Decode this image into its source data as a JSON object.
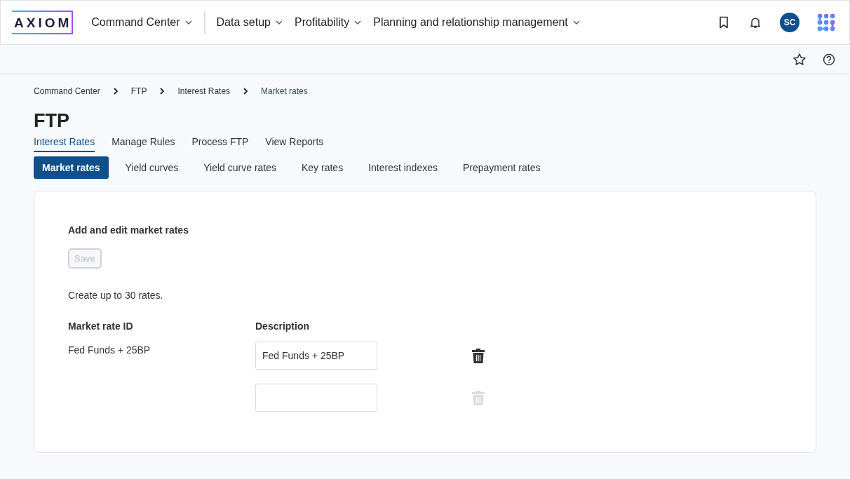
{
  "header": {
    "logo": "AXIOM",
    "nav": [
      {
        "label": "Command Center",
        "kind": "dropdown"
      },
      {
        "label": "Data setup",
        "kind": "dropdown"
      },
      {
        "label": "Profitability",
        "kind": "dropdown"
      },
      {
        "label": "Planning and relationship management",
        "kind": "dropdown"
      }
    ],
    "avatar": "SC"
  },
  "breadcrumb": [
    {
      "label": "Command Center",
      "selected": false
    },
    {
      "label": "FTP",
      "selected": false
    },
    {
      "label": "Interest Rates",
      "selected": false
    },
    {
      "label": "Market rates",
      "selected": true
    }
  ],
  "page_title": "FTP",
  "tabs": [
    {
      "label": "Interest Rates",
      "selected": true
    },
    {
      "label": "Manage Rules",
      "selected": false
    },
    {
      "label": "Process FTP",
      "selected": false
    },
    {
      "label": "View Reports",
      "selected": false
    }
  ],
  "subtabs": [
    {
      "label": "Market rates",
      "selected": true
    },
    {
      "label": "Yield curves",
      "selected": false
    },
    {
      "label": "Yield curve rates",
      "selected": false
    },
    {
      "label": "Key rates",
      "selected": false
    },
    {
      "label": "Interest indexes",
      "selected": false
    },
    {
      "label": "Prepayment rates",
      "selected": false
    }
  ],
  "card": {
    "heading": "Add and edit market rates",
    "save_button": {
      "label": "Save",
      "disabled": true
    },
    "note": "Create up to 30 rates.",
    "columns": [
      "Market rate ID",
      "Description"
    ],
    "rows": [
      {
        "id": "Fed Funds + 25BP",
        "description": "Fed Funds + 25BP",
        "disabled": false
      },
      {
        "disabled": true
      }
    ]
  }
}
